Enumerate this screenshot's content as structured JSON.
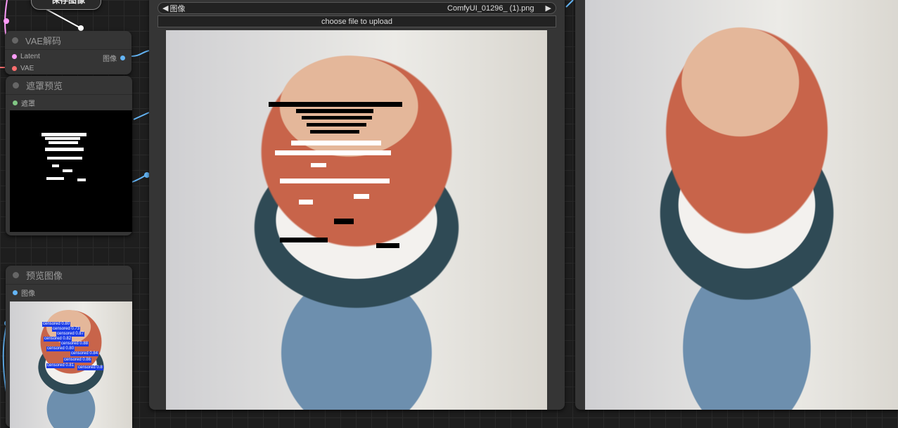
{
  "save_node": {
    "title": "保存图像"
  },
  "vae_decode": {
    "title": "VAE解码",
    "inputs": [
      "Latent",
      "VAE"
    ],
    "output": "图像"
  },
  "mask_preview": {
    "title": "遮罩预览",
    "input": "遮罩"
  },
  "preview_image": {
    "title": "预览图像",
    "input": "图像",
    "detections": [
      "censored 0.80",
      "censored 0.73",
      "censored 0.87",
      "censored 0.82",
      "censored 0.88",
      "censored 0.80",
      "censored 0.84",
      "censored 0.86",
      "censored 0.81",
      "censored 0.8"
    ]
  },
  "load_image": {
    "widget_label": "图像",
    "filename": "ComfyUI_01296_ (1).png",
    "upload_label": "choose file to upload"
  },
  "colors": {
    "latent": "#ff9cf9",
    "vae": "#ff6e6e",
    "image": "#64b5f6",
    "mask": "#81c784"
  }
}
